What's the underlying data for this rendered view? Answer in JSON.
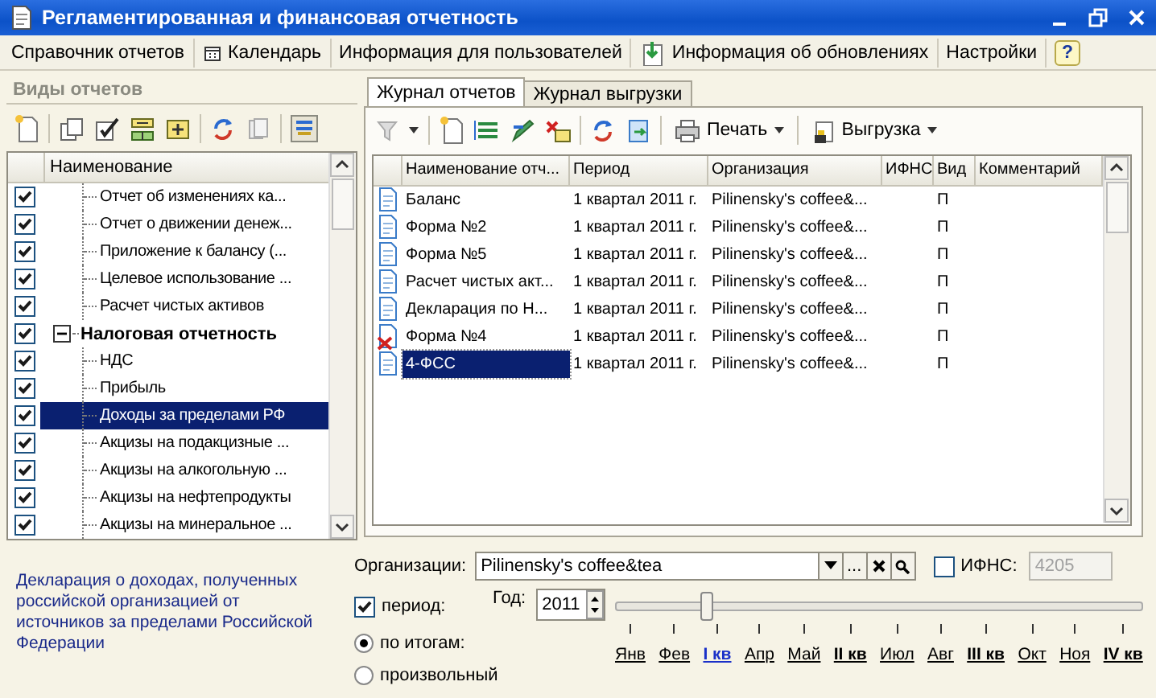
{
  "window": {
    "title": "Регламентированная и финансовая отчетность"
  },
  "menu": [
    {
      "kind": "plain",
      "label": "Справочник отчетов"
    },
    {
      "kind": "calendar",
      "label": "Календарь"
    },
    {
      "kind": "plain",
      "label": "Информация для пользователей"
    },
    {
      "kind": "update",
      "label": "Информация об обновлениях"
    },
    {
      "kind": "plain",
      "label": "Настройки"
    },
    {
      "kind": "help",
      "label": "?"
    }
  ],
  "report_types": {
    "title": "Виды отчетов",
    "column": "Наименование",
    "items": [
      {
        "children": [
          {
            "label": "Отчет об изменениях ка...",
            "checked": true,
            "selected": false
          },
          {
            "label": "Отчет о движении денеж...",
            "checked": true,
            "selected": false
          },
          {
            "label": "Приложение к балансу (...",
            "checked": true,
            "selected": false
          },
          {
            "label": "Целевое использование ...",
            "checked": true,
            "selected": false
          },
          {
            "label": "Расчет чистых активов",
            "checked": true,
            "selected": false
          }
        ]
      },
      {
        "label": "Налоговая отчетность",
        "checked": true,
        "expanded": true,
        "selected": false,
        "children": [
          {
            "label": "НДС",
            "checked": true,
            "selected": false
          },
          {
            "label": "Прибыль",
            "checked": true,
            "selected": false
          },
          {
            "label": "Доходы за пределами РФ",
            "checked": true,
            "selected": true
          },
          {
            "label": "Акцизы на подакцизные ...",
            "checked": true,
            "selected": false
          },
          {
            "label": "Акцизы на алкогольную ...",
            "checked": true,
            "selected": false
          },
          {
            "label": "Акцизы на нефтепродукты",
            "checked": true,
            "selected": false
          },
          {
            "label": "Акцизы на минеральное ...",
            "checked": true,
            "selected": false
          }
        ]
      }
    ]
  },
  "description": "Декларация о доходах, полученных российской организацией от источников за пределами Российской Федерации",
  "tabs": [
    {
      "label": "Журнал отчетов",
      "selected": true
    },
    {
      "label": "Журнал выгрузки",
      "selected": false
    }
  ],
  "journal_toolbar": {
    "print": "Печать",
    "export": "Выгрузка"
  },
  "journal": {
    "columns": [
      "Наименование отч...",
      "Период",
      "Организация",
      "ИФНС",
      "Вид",
      "Комментарий"
    ],
    "rows": [
      {
        "kind": "document",
        "name": "Баланс",
        "period": "1 квартал 2011 г.",
        "organization": "Pilinensky's coffee&...",
        "type": "П",
        "selected": false
      },
      {
        "kind": "document",
        "name": "Форма №2",
        "period": "1 квартал 2011 г.",
        "organization": "Pilinensky's coffee&...",
        "type": "П",
        "selected": false
      },
      {
        "kind": "document",
        "name": "Форма №5",
        "period": "1 квартал 2011 г.",
        "organization": "Pilinensky's coffee&...",
        "type": "П",
        "selected": false
      },
      {
        "kind": "document",
        "name": "Расчет чистых акт...",
        "period": "1 квартал 2011 г.",
        "organization": "Pilinensky's coffee&...",
        "type": "П",
        "selected": false
      },
      {
        "kind": "document",
        "name": "Декларация по Н...",
        "period": "1 квартал 2011 г.",
        "organization": "Pilinensky's coffee&...",
        "type": "П",
        "selected": false
      },
      {
        "kind": "rejected",
        "name": "Форма №4",
        "period": "1 квартал 2011 г.",
        "organization": "Pilinensky's coffee&...",
        "type": "П",
        "selected": false
      },
      {
        "kind": "document",
        "name": "4-ФСС",
        "period": "1 квартал 2011 г.",
        "organization": "Pilinensky's coffee&...",
        "type": "П",
        "selected": true
      }
    ]
  },
  "filter": {
    "organization_label": "Организации:",
    "organization": "Pilinensky's coffee&tea",
    "select_button": "...",
    "ifns": {
      "label": "ИФНС:",
      "checked": false,
      "value": "4205",
      "disabled": true
    },
    "period": {
      "label": "период:",
      "checked": true
    },
    "year_label": "Год:",
    "year": "2011",
    "slider": {
      "level": 0.17
    },
    "modes": [
      {
        "label": "по итогам:",
        "selected": true
      },
      {
        "label": "произвольный",
        "selected": false
      }
    ],
    "months": [
      {
        "kind": "month",
        "label": "Янв",
        "selected": false
      },
      {
        "kind": "month",
        "label": "Фев",
        "selected": false
      },
      {
        "kind": "quarter",
        "label": "I кв",
        "selected": true
      },
      {
        "kind": "month",
        "label": "Апр",
        "selected": false
      },
      {
        "kind": "month",
        "label": "Май",
        "selected": false
      },
      {
        "kind": "quarter",
        "label": "II кв",
        "selected": false
      },
      {
        "kind": "month",
        "label": "Июл",
        "selected": false
      },
      {
        "kind": "month",
        "label": "Авг",
        "selected": false
      },
      {
        "kind": "quarter",
        "label": "III кв",
        "selected": false
      },
      {
        "kind": "month",
        "label": "Окт",
        "selected": false
      },
      {
        "kind": "month",
        "label": "Ноя",
        "selected": false
      },
      {
        "kind": "quarter",
        "label": "IV кв",
        "selected": false
      }
    ]
  }
}
